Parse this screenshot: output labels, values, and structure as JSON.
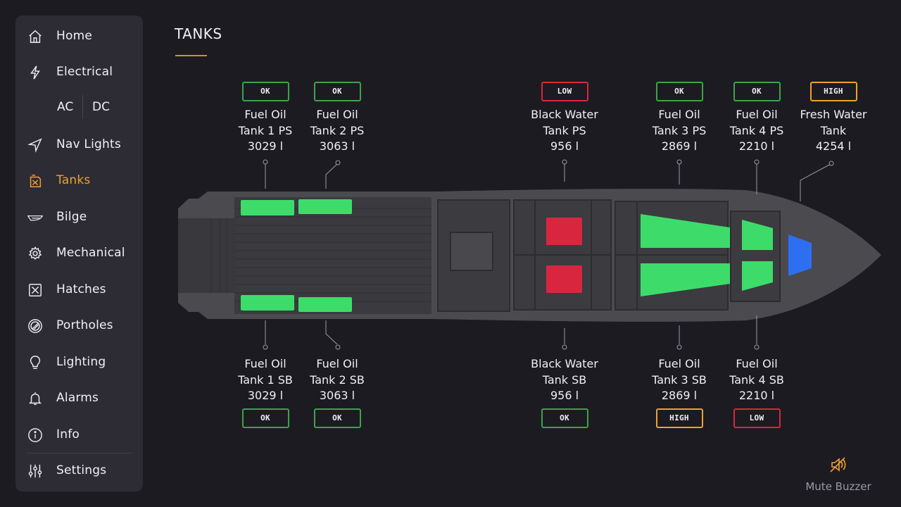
{
  "sidebar": {
    "items": [
      {
        "label": "Home",
        "icon": "home-icon"
      },
      {
        "label": "Electrical",
        "icon": "lightning-icon"
      },
      {
        "label": "Nav Lights",
        "icon": "navigation-arrow-icon"
      },
      {
        "label": "Tanks",
        "icon": "fuel-can-icon",
        "active": true
      },
      {
        "label": "Bilge",
        "icon": "boat-hull-icon"
      },
      {
        "label": "Mechanical",
        "icon": "gear-icon"
      },
      {
        "label": "Hatches",
        "icon": "hatch-icon"
      },
      {
        "label": "Portholes",
        "icon": "porthole-icon"
      },
      {
        "label": "Lighting",
        "icon": "lightbulb-icon"
      },
      {
        "label": "Alarms",
        "icon": "bell-icon"
      },
      {
        "label": "Info",
        "icon": "info-icon"
      },
      {
        "label": "Settings",
        "icon": "sliders-icon"
      }
    ],
    "electrical_sub": {
      "ac": "AC",
      "dc": "DC"
    }
  },
  "header": {
    "title": "TANKS"
  },
  "colors": {
    "accent": "#f0a030",
    "ok": "#3fa24b",
    "low": "#d8283a",
    "high": "#f0a030",
    "fuel_fill": "#3ddc6a",
    "black_water_fill": "#d8263f",
    "fresh_water_fill": "#2d6ff0"
  },
  "tanks": {
    "fuel1_ps": {
      "line1": "Fuel Oil",
      "line2": "Tank 1 PS",
      "volume": "3029 l",
      "status": "OK"
    },
    "fuel2_ps": {
      "line1": "Fuel Oil",
      "line2": "Tank 2 PS",
      "volume": "3063 l",
      "status": "OK"
    },
    "black_ps": {
      "line1": "Black Water",
      "line2": "Tank PS",
      "volume": "956 l",
      "status": "LOW"
    },
    "fuel3_ps": {
      "line1": "Fuel Oil",
      "line2": "Tank 3 PS",
      "volume": "2869 l",
      "status": "OK"
    },
    "fuel4_ps": {
      "line1": "Fuel Oil",
      "line2": "Tank 4 PS",
      "volume": "2210 l",
      "status": "OK"
    },
    "fresh": {
      "line1": "Fresh Water",
      "line2": "Tank",
      "volume": "4254 l",
      "status": "HIGH"
    },
    "fuel1_sb": {
      "line1": "Fuel Oil",
      "line2": "Tank 1 SB",
      "volume": "3029 l",
      "status": "OK"
    },
    "fuel2_sb": {
      "line1": "Fuel Oil",
      "line2": "Tank 2 SB",
      "volume": "3063 l",
      "status": "OK"
    },
    "black_sb": {
      "line1": "Black Water",
      "line2": "Tank SB",
      "volume": "956 l",
      "status": "OK"
    },
    "fuel3_sb": {
      "line1": "Fuel Oil",
      "line2": "Tank 3 SB",
      "volume": "2869 l",
      "status": "HIGH"
    },
    "fuel4_sb": {
      "line1": "Fuel Oil",
      "line2": "Tank 4 SB",
      "volume": "2210 l",
      "status": "LOW"
    }
  },
  "mute": {
    "label": "Mute Buzzer",
    "icon": "buzzer-mute-icon"
  }
}
